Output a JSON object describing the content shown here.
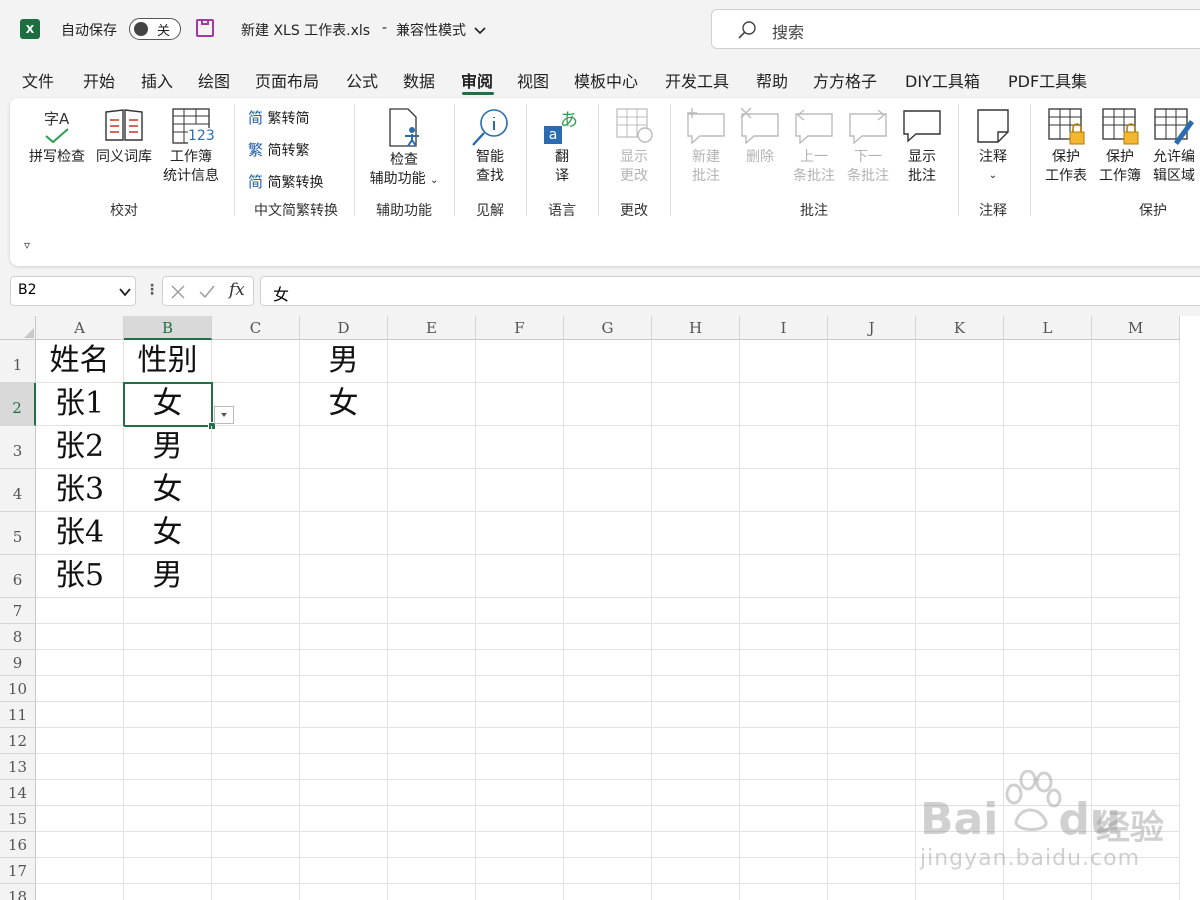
{
  "titlebar": {
    "app_icon": "excel-icon",
    "autosave_label": "自动保存",
    "autosave_toggle": "关",
    "file_name": "新建 XLS 工作表.xls",
    "separator": "-",
    "mode": "兼容性模式",
    "search_placeholder": "搜索"
  },
  "tabs": [
    "文件",
    "开始",
    "插入",
    "绘图",
    "页面布局",
    "公式",
    "数据",
    "审阅",
    "视图",
    "模板中心",
    "开发工具",
    "帮助",
    "方方格子",
    "DIY工具箱",
    "PDF工具集"
  ],
  "active_tab": "审阅",
  "ribbon": {
    "groups": {
      "proofing": "校对",
      "chinese_conv": "中文简繁转换",
      "accessibility": "辅助功能",
      "insights": "见解",
      "language": "语言",
      "changes": "更改",
      "comments": "批注",
      "notes": "注释",
      "protect": "保护"
    },
    "buttons": {
      "spell_check": "拼写检查",
      "thesaurus": "同义词库",
      "stats_1": "工作簿",
      "stats_2": "统计信息",
      "trad_to_simp": "繁转简",
      "simp_to_trad": "简转繁",
      "conv": "简繁转换",
      "check_1": "检查",
      "check_2": "辅助功能",
      "smart_1": "智能",
      "smart_2": "查找",
      "translate_1": "翻",
      "translate_2": "译",
      "show_changes_1": "显示",
      "show_changes_2": "更改",
      "new_comment_1": "新建",
      "new_comment_2": "批注",
      "delete": "删除",
      "prev_1": "上一",
      "prev_2": "条批注",
      "next_1": "下一",
      "next_2": "条批注",
      "show_comments_1": "显示",
      "show_comments_2": "批注",
      "notes": "注释",
      "protect_sheet_1": "保护",
      "protect_sheet_2": "工作表",
      "protect_wb_1": "保护",
      "protect_wb_2": "工作簿",
      "allow_edit_1": "允许编",
      "allow_edit_2": "辑区域"
    },
    "icon_texts": {
      "spell": "字A",
      "stats": "123",
      "simp_char": "简",
      "trad_char": "繁",
      "translate_top": "あ",
      "translate_bottom": "a"
    }
  },
  "formula_bar": {
    "name_box": "B2",
    "fx_label": "fx",
    "value": "女"
  },
  "columns": [
    "A",
    "B",
    "C",
    "D",
    "E",
    "F",
    "G",
    "H",
    "I",
    "J",
    "K",
    "L",
    "M"
  ],
  "rows": [
    "1",
    "2",
    "3",
    "4",
    "5",
    "6",
    "7",
    "8",
    "9",
    "10",
    "11",
    "12",
    "13",
    "14",
    "15",
    "16",
    "17",
    "18"
  ],
  "selected_cell": "B2",
  "cells": {
    "A1": "姓名",
    "B1": "性别",
    "D1": "男",
    "A2": "张1",
    "B2": "女",
    "D2": "女",
    "A3": "张2",
    "B3": "男",
    "A4": "张3",
    "B4": "女",
    "A5": "张4",
    "B5": "女",
    "A6": "张5",
    "B6": "男"
  },
  "watermark": {
    "brand": "Bai",
    "brand2": "du",
    "cn": "经验",
    "url": "jingyan.baidu.com"
  },
  "colors": {
    "accent": "#1e7145",
    "excel_green": "#1d6f42",
    "save_purple": "#a23aa0"
  }
}
